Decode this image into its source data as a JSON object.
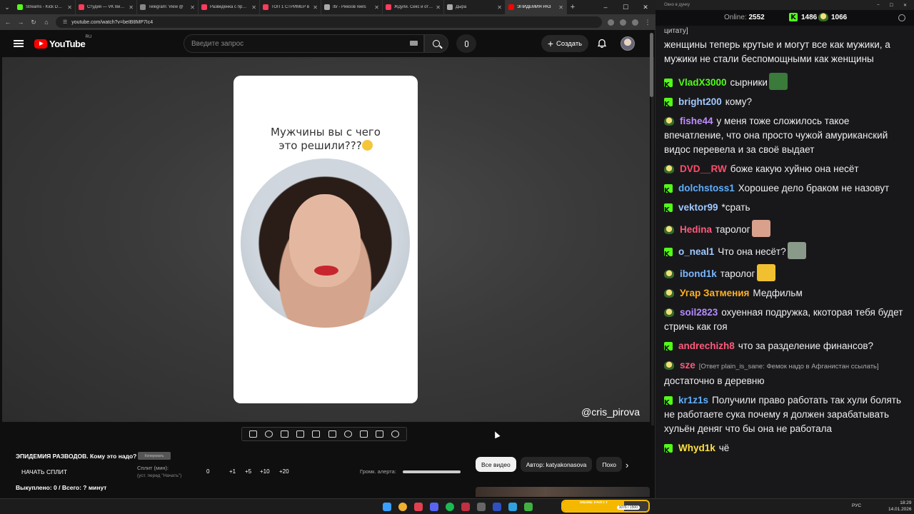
{
  "browser": {
    "tabs": [
      {
        "title": "Streams - Kick Dashb",
        "color": "#53fc18"
      },
      {
        "title": "Студия — VK Видео",
        "color": "#ff3b5c"
      },
      {
        "title": "Telegram: View @",
        "color": "#888888"
      },
      {
        "title": "Разведёнка с прицеп",
        "color": "#ff3b5c"
      },
      {
        "title": "ТОП 1 СТРИМЕР в",
        "color": "#ff3b5c"
      },
      {
        "title": "/b/ - Рикоов reels",
        "color": "#aaaaaa"
      },
      {
        "title": "Ждули. Секс и отно",
        "color": "#ff3b5c"
      },
      {
        "title": "Дыра",
        "color": "#aaaaaa"
      },
      {
        "title": "ЭПИДЕМИЯ РАЗ",
        "color": "#ff0000",
        "active": true
      }
    ],
    "url": "youtube.com/watch?v=beIB8MP7Ic4"
  },
  "youtube": {
    "logo_text": "YouTube",
    "region": "RU",
    "search_placeholder": "Введите запрос",
    "create_label": "Создать",
    "caption_line1": "Мужчины вы с чего",
    "caption_line2": "это решили???",
    "watermark": "@cris_pirova"
  },
  "extension": {
    "video_title": "ЭПИДЕМИЯ РАЗВОДОВ. Кому это надо?",
    "copy_label": "Копировать",
    "start_split": "НАЧАТЬ СПЛИТ",
    "split_label": "Сплит (мин):",
    "split_hint": "(уст. перед \"Начать\")",
    "split_value": "0",
    "steps": [
      "+1",
      "+5",
      "+10",
      "+20"
    ],
    "alert_label": "Громк. алерта:",
    "bought": "Выкуплено: 0 / Всего: ? минут"
  },
  "chips": {
    "items": [
      "Все видео",
      "Автор: katyakonasova",
      "Похо"
    ]
  },
  "chat": {
    "window_title": "Окно в дунку",
    "online_label": "Online:",
    "online_count": "2552",
    "kick_count": "1486",
    "other_count": "1066",
    "messages": [
      {
        "plat": "",
        "user": "",
        "user_color": "#ffffff",
        "text": "цитату]",
        "small": true
      },
      {
        "plat": "",
        "user": "",
        "user_color": "#ffffff",
        "text": "женщины теперь крутые и могут все как мужики, а мужики не стали беспомощными как женщины"
      },
      {
        "plat": "k",
        "user": "VladX3000",
        "user_color": "#53fc18",
        "text": "сырники",
        "emote": "#3a7a3a"
      },
      {
        "plat": "k",
        "user": "bright200",
        "user_color": "#a0c8ff",
        "text": "кому?"
      },
      {
        "plat": "p",
        "user": "fishe44",
        "user_color": "#c08cff",
        "text": "у меня тоже сложилось такое впечатление, что она просто чужой амуриканский видос перевела и за своё выдает"
      },
      {
        "plat": "p",
        "user": "DVD__RW",
        "user_color": "#ff4d6a",
        "text": "боже какую хуйню она несёт"
      },
      {
        "plat": "k",
        "user": "dolchstoss1",
        "user_color": "#5fb0ff",
        "text": "Хорошее дело браком не назовут"
      },
      {
        "plat": "k",
        "user": "vektor99",
        "user_color": "#a0c8ff",
        "text": "*срать"
      },
      {
        "plat": "p",
        "user": "Hedina",
        "user_color": "#ff5a7a",
        "text": "таролог",
        "emote": "#d9a08c"
      },
      {
        "plat": "k",
        "user": "o_neal1",
        "user_color": "#a0c8ff",
        "text": "Что она несёт?",
        "emote": "#8a9a8a"
      },
      {
        "plat": "p",
        "user": "ibond1k",
        "user_color": "#7ab8ff",
        "text": "таролог",
        "emote": "#f0c030"
      },
      {
        "plat": "p",
        "user": "Угар Затмения",
        "user_color": "#ffb020",
        "text": "Медфильм"
      },
      {
        "plat": "p",
        "user": "soil2823",
        "user_color": "#b48cff",
        "text": "охуенная подружка, ккоторая тебя будет стричь как гоя"
      },
      {
        "plat": "k",
        "user": "andrechizh8",
        "user_color": "#ff5a7a",
        "text": "что за разделение финансов?"
      },
      {
        "plat": "p",
        "user": "sze",
        "user_color": "#ff5a7a",
        "reply": "[Ответ plain_is_sane: Фемок надо в Афганистан ссылать]",
        "text": "достаточно в деревню"
      },
      {
        "plat": "k",
        "user": "kr1z1s",
        "user_color": "#5fb0ff",
        "text": "Получили право работать так хули болять не работаете сука почему я должен зарабатывать хульён деняг что бы она не работала"
      },
      {
        "plat": "k",
        "user": "Whyd1k",
        "user_color": "#ffe040",
        "text": "чё"
      }
    ]
  },
  "taskbar": {
    "meme_title": "MEME PARTY",
    "meme_count": "1076 / 1500",
    "meme_progress": 0.72,
    "lang": "РУС",
    "time": "18:29",
    "date": "14.01.2026"
  }
}
